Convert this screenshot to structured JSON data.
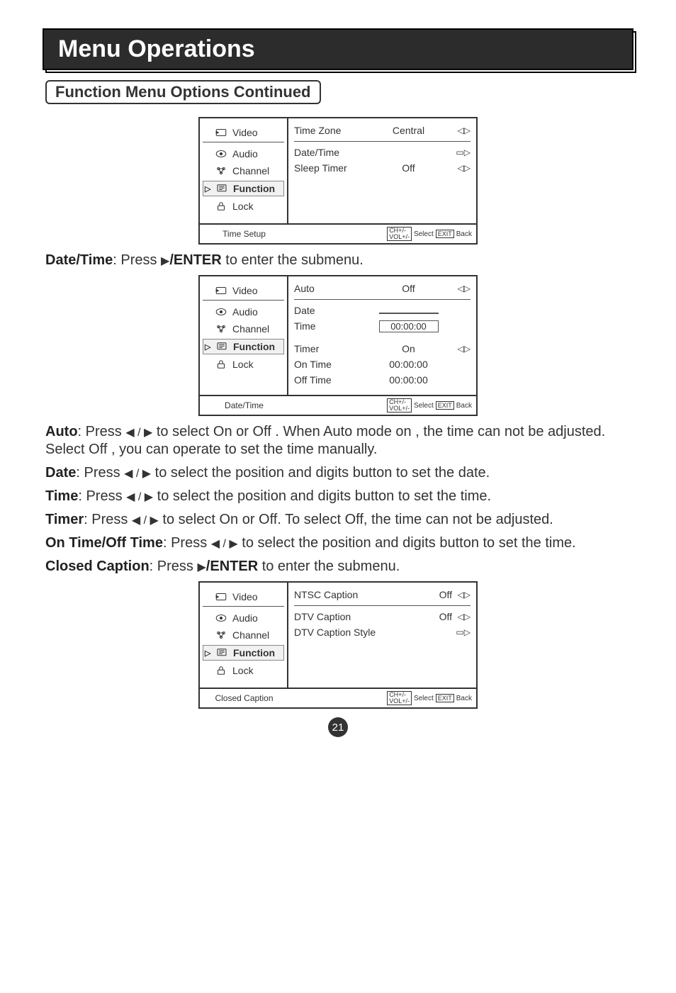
{
  "header": {
    "title": "Menu Operations",
    "subtitle": "Function Menu Options Continued"
  },
  "sidebar": {
    "items": [
      {
        "label": "Video"
      },
      {
        "label": "Audio"
      },
      {
        "label": "Channel"
      },
      {
        "label": "Function"
      },
      {
        "label": "Lock"
      }
    ]
  },
  "glyphs": {
    "lr": "◁▷",
    "enter": "▭▷",
    "right": "▶",
    "lrsolid": "◀ / ▶"
  },
  "osd1": {
    "footer_title": "Time Setup",
    "rows": [
      {
        "label": "Time Zone",
        "value": "Central",
        "glyph": "◁▷"
      },
      {
        "label": "Date/Time",
        "value": "",
        "glyph": "▭▷"
      },
      {
        "label": "Sleep Timer",
        "value": "Off",
        "glyph": "◁▷"
      }
    ]
  },
  "osd2": {
    "footer_title": "Date/Time",
    "rows_top": [
      {
        "label": "Auto",
        "value": "Off",
        "glyph": "◁▷"
      },
      {
        "label": "Date",
        "value": "",
        "boxed": true
      },
      {
        "label": "Time",
        "value": "00:00:00",
        "boxed": true
      }
    ],
    "rows_bottom": [
      {
        "label": "Timer",
        "value": "On",
        "glyph": "◁▷"
      },
      {
        "label": "On Time",
        "value": "00:00:00"
      },
      {
        "label": "Off Time",
        "value": "00:00:00"
      }
    ]
  },
  "osd3": {
    "footer_title": "Closed Caption",
    "rows": [
      {
        "label": "NTSC Caption",
        "value": "Off",
        "glyph": "◁▷"
      },
      {
        "label": "DTV Caption",
        "value": "Off",
        "glyph": "◁▷"
      },
      {
        "label": "DTV Caption Style",
        "value": "",
        "glyph": "▭▷"
      }
    ]
  },
  "text": {
    "date_time_intro_label": "Date/Time",
    "date_time_intro_rest": ": Press",
    "enter_label": "/ENTER",
    "date_time_intro_tail": " to enter the submenu.",
    "auto_label": "Auto",
    "auto_rest": ": Press ",
    "auto_tail1": " to select On or Off . When Auto mode on , the time can not be adjusted. Select Off , you can operate to set the time manually.",
    "date_label": "Date",
    "date_tail": " to select the position and digits button to set the date.",
    "time_label": "Time",
    "time_tail": " to select the position and digits button to set the time.",
    "timer_label": "Timer",
    "timer_tail": " to select On or Off. To select Off, the time can not be adjusted.",
    "onoff_label": "On Time/Off Time",
    "onoff_tail": " to select the position and digits button to set the time.",
    "cc_label": "Closed Caption",
    "cc_tail": " to enter the submenu."
  },
  "footer_hints": {
    "ch": "CH+/-",
    "vol": "VOL+/-",
    "select": "Select",
    "exit": "EXIT",
    "back": "Back"
  },
  "page_number": "21"
}
